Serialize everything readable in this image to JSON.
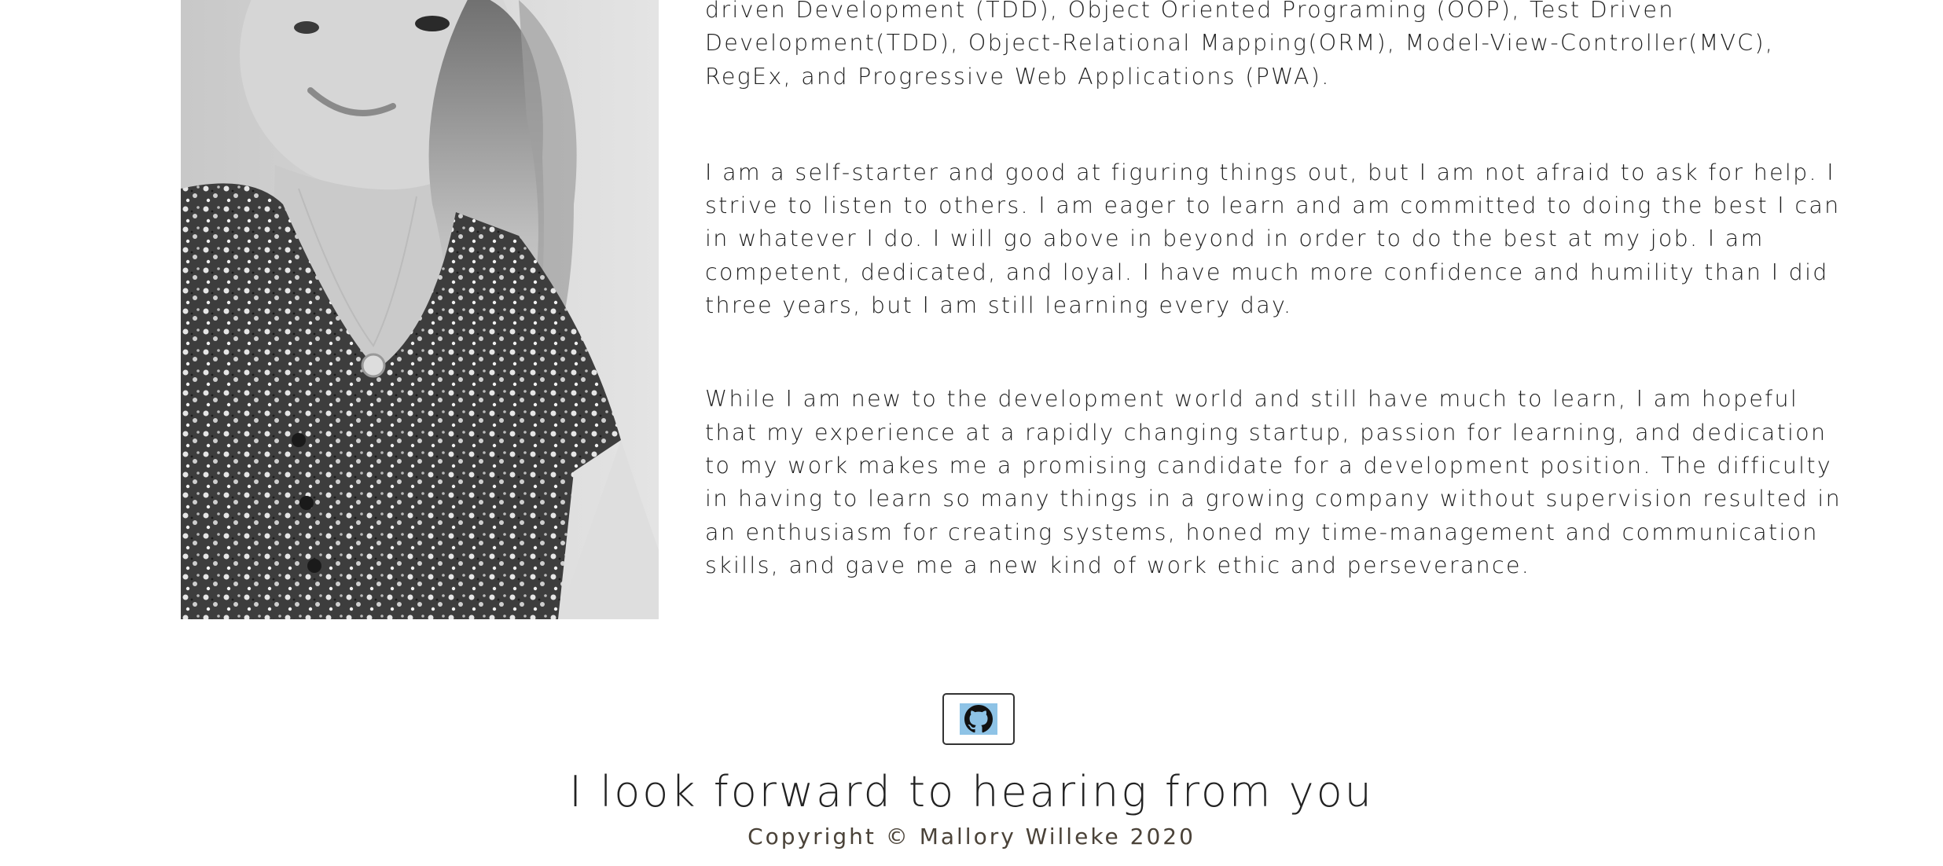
{
  "about": {
    "paragraphs": [
      "driven Development (TDD), Object Oriented Programing (OOP), Test Driven Development(TDD), Object-Relational Mapping(ORM), Model-View-Controller(MVC), RegEx, and Progressive Web Applications (PWA).",
      "I am a self-starter and good at figuring things out, but I am not afraid to ask for help. I strive to listen to others. I am eager to learn and am committed to doing the best I can in whatever I do. I will go above in beyond in order to do the best at my job. I am competent, dedicated, and loyal. I have much more confidence and humility than I did three years, but I am still learning every day.",
      "While I am new to the development world and still have much to learn, I am hopeful that my experience at a rapidly changing startup, passion for learning, and dedication to my work makes me a promising candidate for a development position. The difficulty in having to learn so many things in a growing company without supervision resulted in an enthusiasm for creating systems, honed my time-management and communication skills, and gave me a new kind of work ethic and perseverance."
    ]
  },
  "footer": {
    "github_icon": "github-icon",
    "closing": "I look forward to hearing from you",
    "copyright": "Copyright © Mallory Willeke 2020"
  },
  "colors": {
    "github_icon_bg": "#8ec3e6",
    "copyright_text": "#4a4238"
  }
}
